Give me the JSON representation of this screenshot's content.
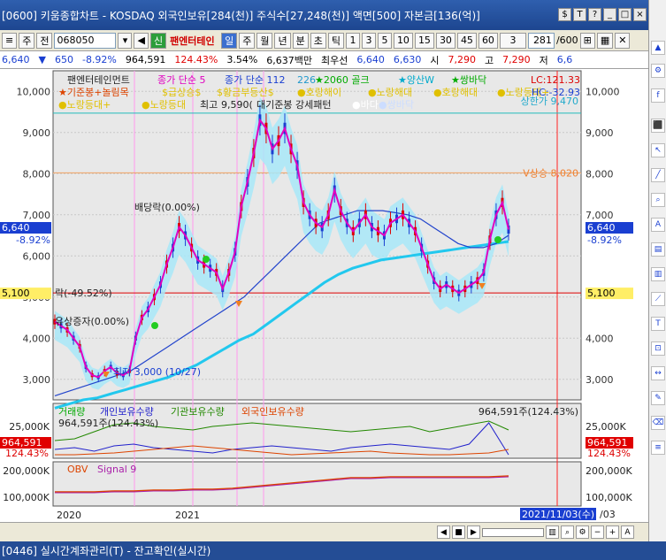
{
  "window": {
    "title": "[0600] 키움종합차트 - KOSDAQ 외국인보유[284(천)] 주식수[27,248(천)] 액면[500] 자본금[136(억)]",
    "buttons": [
      "$",
      "T",
      "?",
      "_",
      "□",
      "×"
    ]
  },
  "toolbar": {
    "market": "주",
    "prev_label": "전",
    "code": "068050",
    "name": "팬엔터테인",
    "signal_label": "신",
    "periods": [
      "일",
      "주",
      "월",
      "년",
      "분",
      "초",
      "틱"
    ],
    "active_period": "일",
    "intervals": [
      "1",
      "3",
      "5",
      "10",
      "15",
      "30",
      "45",
      "60"
    ],
    "interval_select": "3",
    "count": "281",
    "count_total": "/600"
  },
  "quote": {
    "price": "6,640",
    "change": "650",
    "change_pct": "-8.92%",
    "volume": "964,591",
    "volume_ratio": "124.43%",
    "turnover": "3.54%",
    "amount": "6,637백만",
    "best_label": "최우선",
    "bid": "6,640",
    "ask": "6,630",
    "open_label": "시",
    "open": "7,290",
    "high_label": "고",
    "high": "7,290",
    "low_label": "저",
    "low": "6,6"
  },
  "chart_data": {
    "type": "line",
    "title": "팬엔터테인먼트",
    "ylim": [
      2500,
      10500
    ],
    "yticks": [
      "10,000",
      "9,000",
      "8,000",
      "7,000",
      "6,000",
      "5,000",
      "4,000",
      "3,000"
    ],
    "xticks": [
      "2020",
      "2021"
    ],
    "series": [
      {
        "name": "종가 단순 5",
        "color": "#e000c0"
      },
      {
        "name": "종가 단순 112",
        "color": "#2244cc"
      },
      {
        "name": "226",
        "color": "#22c8ee"
      }
    ],
    "price_path": [
      4400,
      4300,
      4200,
      4000,
      3800,
      3300,
      3100,
      3050,
      3200,
      3300,
      3150,
      3100,
      3200,
      4000,
      4500,
      4700,
      5000,
      5300,
      5800,
      6200,
      6700,
      6500,
      6200,
      5900,
      5800,
      5700,
      5600,
      5200,
      5600,
      6100,
      7200,
      7800,
      8500,
      9300,
      9100,
      8600,
      8800,
      9100,
      8600,
      8200,
      7300,
      7000,
      6800,
      6700,
      7000,
      7600,
      7100,
      6800,
      6600,
      6800,
      7000,
      6700,
      6600,
      6500,
      6800,
      6900,
      7000,
      6800,
      6600,
      6200,
      5800,
      5400,
      5200,
      5300,
      5200,
      5100,
      5200,
      5300,
      5400,
      5600,
      6400,
      7000,
      7300,
      6640
    ],
    "ma112": [
      2600,
      2700,
      2800,
      2900,
      3000,
      3100,
      3200,
      3400,
      3600,
      3800,
      4000,
      4200,
      4400,
      4600,
      4800,
      5000,
      5300,
      5600,
      5900,
      6200,
      6500,
      6800,
      6900,
      7000,
      7100,
      7100,
      7100,
      7050,
      7000,
      6900,
      6700,
      6500,
      6300,
      6200,
      6200,
      6300,
      6500
    ],
    "ma226": [
      2300,
      2400,
      2500,
      2550,
      2650,
      2750,
      2850,
      2950,
      3050,
      3200,
      3350,
      3550,
      3750,
      3950,
      4100,
      4350,
      4600,
      4850,
      5100,
      5350,
      5550,
      5700,
      5800,
      5900,
      5950,
      6000,
      6050,
      6100,
      6150,
      6200,
      6250,
      6300,
      6350
    ],
    "indicators": [
      "★기준봉+놀림목",
      "$급상승$",
      "$황금부등산$",
      "●호랑해이",
      "●노랑해대",
      "●호랑해대",
      "●노랑등대+",
      "●노랑등대+",
      "●노랑등대",
      "최고",
      "9,590(",
      "대기준봉 강세패턴",
      "●바다",
      "●쌍바닥",
      "★2060 골크",
      "★양산W",
      "★쌍바닥"
    ],
    "labels": {
      "upper_limit": "상한가 9,470",
      "strong_line": "V상승 8,020",
      "dividend": "배당락(0.00%)",
      "rights": "락(-49.52%)",
      "rights2": "유상증자(0.00%)",
      "low_mark": "최저 3,000 (10/27)",
      "lc": "LC:121.33",
      "hc": "HC:-32.93"
    },
    "right_axis": {
      "price": "6,640",
      "pct": "-8.92%",
      "line": "5,100"
    },
    "left_axis": {
      "price": "6,640",
      "pct": "-8.92%",
      "line": "5,100"
    }
  },
  "volume_panel": {
    "legend": [
      "거래량",
      "개인보유수량",
      "기관보유수량",
      "외국인보유수량"
    ],
    "legend_colors": [
      "#00aa00",
      "#2222cc",
      "#228800",
      "#dd4400"
    ],
    "value": "964,591주(124.43%)",
    "sub": "964,591주(124.43%)",
    "ytick": "25,000K",
    "badge": "964,591",
    "badge_pct": "124.43%"
  },
  "obv_panel": {
    "legend": [
      "OBV",
      "Signal 9"
    ],
    "yticks": [
      "200,000K",
      "100,000K"
    ],
    "date": "2021/11/03(수)",
    "date_suffix": "/03"
  },
  "status": {
    "text": "[0446] 실시간계좌관리(T) - 잔고확인(실시간)"
  },
  "colors": {
    "titlebar": "#1d4690",
    "price_line": "#e000c0",
    "ma112": "#2244cc",
    "ma226": "#22c8ee",
    "band": "#a8e8f8"
  }
}
